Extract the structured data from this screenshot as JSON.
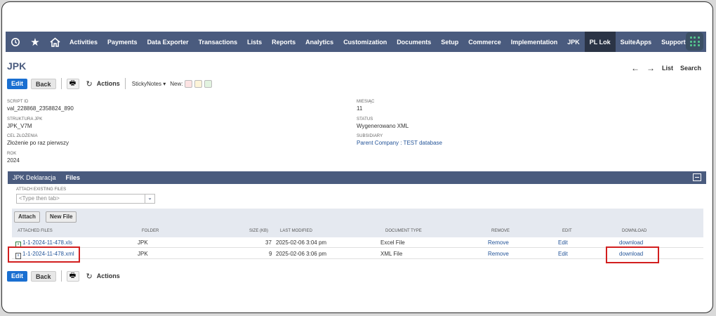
{
  "nav": {
    "items": [
      "Activities",
      "Payments",
      "Data Exporter",
      "Transactions",
      "Lists",
      "Reports",
      "Analytics",
      "Customization",
      "Documents",
      "Setup",
      "Commerce",
      "Implementation",
      "JPK",
      "PL Lok",
      "SuiteApps",
      "Support"
    ],
    "active": "PL Lok",
    "icons": [
      "recent-icon",
      "star-icon",
      "home-icon"
    ]
  },
  "page": {
    "title": "JPK",
    "list_link": "List",
    "search_link": "Search"
  },
  "toolbar": {
    "edit": "Edit",
    "back": "Back",
    "actions": "Actions",
    "sticky_notes": "StickyNotes ▾",
    "new_label": "New:",
    "swatch_colors": [
      "#fde3e3",
      "#fdf4d8",
      "#e2f3e0"
    ]
  },
  "fields": {
    "script_id": {
      "label": "Script ID",
      "value": "val_228868_2358824_890"
    },
    "struktura": {
      "label": "Struktura JPK",
      "value": "JPK_V7M"
    },
    "cel": {
      "label": "Cel złożenia",
      "value": "Złożenie po raz pierwszy"
    },
    "rok": {
      "label": "Rok",
      "value": "2024"
    },
    "miesiac": {
      "label": "Miesiąc",
      "value": "11"
    },
    "status": {
      "label": "Status",
      "value": "Wygenerowano XML"
    },
    "subsidiary": {
      "label": "Subsidiary",
      "value": "Parent Company : TEST database"
    }
  },
  "tabs": {
    "items": [
      "JPK Deklaracja",
      "Files"
    ],
    "active": "Files"
  },
  "files": {
    "attach_label": "ATTACH EXISTING FILES",
    "attach_placeholder": "<Type then tab>",
    "attach_button": "Attach",
    "new_file_button": "New File",
    "columns": [
      "ATTACHED FILES",
      "FOLDER",
      "SIZE (KB)",
      "LAST MODIFIED",
      "DOCUMENT TYPE",
      "REMOVE",
      "EDIT",
      "DOWNLOAD"
    ],
    "rows": [
      {
        "name": "1-1-2024-11-478.xls",
        "folder": "JPK",
        "size": "37",
        "modified": "2025-02-06 3:04 pm",
        "type": "Excel File",
        "remove": "Remove",
        "edit": "Edit",
        "download": "download"
      },
      {
        "name": "1-1-2024-11-478.xml",
        "folder": "JPK",
        "size": "9",
        "modified": "2025-02-06 3:06 pm",
        "type": "XML File",
        "remove": "Remove",
        "edit": "Edit",
        "download": "download"
      }
    ]
  },
  "highlight_color": "#d21f1f"
}
